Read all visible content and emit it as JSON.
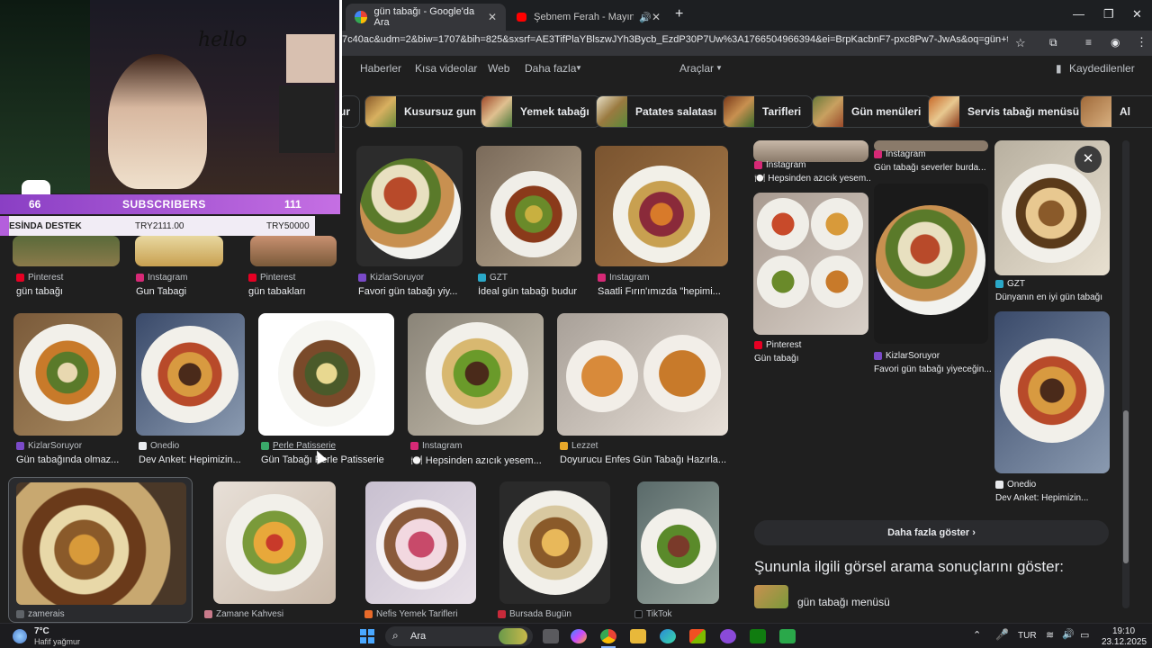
{
  "tabs": [
    {
      "title": "gün tabağı - Google'da Ara",
      "active": true
    },
    {
      "title": "Şebnem Ferah - Mayın Tarla",
      "active": false
    }
  ],
  "address": {
    "url": "7c40ac&udm=2&biw=1707&bih=825&sxsrf=AE3TifPlaYBlszwJYh3Bycb_EzdP30P7Uw%3A1766504966394&ei=BrpKacbnF7-pxc8Pw7-JwAs&oq=gün+tab&g..."
  },
  "google_nav": {
    "haberler": "Haberler",
    "kisa_videolar": "Kısa videolar",
    "web": "Web",
    "daha_fazla": "Daha fazla",
    "araclar": "Araçlar",
    "kaydedilenler": "Kaydedilenler"
  },
  "chips": [
    "ur",
    "Kusursuz gun",
    "Yemek tabağı",
    "Patates salatası",
    "Tarifleri",
    "Gün menüleri",
    "Servis tabağı menüsü",
    "Al"
  ],
  "row1": [
    {
      "source": "Pinterest",
      "title": "gün tabağı"
    },
    {
      "source": "Instagram",
      "title": "Gun Tabagi"
    },
    {
      "source": "Pinterest",
      "title": "gün tabakları"
    },
    {
      "source": "KizlarSoruyor",
      "title": "Favori gün tabağı yiy..."
    },
    {
      "source": "GZT",
      "title": "İdeal gün tabağı budur"
    },
    {
      "source": "Instagram",
      "title": "Saatli Fırın'ımızda \"hepimi..."
    }
  ],
  "row2": [
    {
      "source": "KizlarSoruyor",
      "title": "Gün tabağında olmaz..."
    },
    {
      "source": "Onedio",
      "title": "Dev Anket: Hepimizin..."
    },
    {
      "source": "Perle Patisserie",
      "title": "Gün Tabağı Perle Patisserie"
    },
    {
      "source": "Instagram",
      "title": "🍽️ Hepsinden azıcık yesem..."
    },
    {
      "source": "Lezzet",
      "title": "Doyurucu Enfes Gün Tabağı Hazırla..."
    }
  ],
  "row3": [
    {
      "source": "zamerais"
    },
    {
      "source": "Zamane Kahvesi"
    },
    {
      "source": "Nefis Yemek Tarifleri"
    },
    {
      "source": "Bursada Bugün"
    },
    {
      "source": "TikTok"
    }
  ],
  "panel": {
    "top_left": {
      "source": "Instagram",
      "title": "🍽️ Hepsinden azıcık yesem..."
    },
    "top_mid": {
      "source": "Instagram",
      "title": "Gün tabağı severler burda..."
    },
    "gzt": {
      "source": "GZT",
      "title": "Dünyanın en iyi gün tabağı"
    },
    "pinterest": {
      "source": "Pinterest",
      "title": "Gün tabağı"
    },
    "kizlar": {
      "source": "KizlarSoruyor",
      "title": "Favori gün tabağı yiyeceğin..."
    },
    "onedio": {
      "source": "Onedio",
      "title": "Dev Anket: Hepimizin..."
    },
    "more_button": "Daha fazla göster",
    "related_heading": "Şununla ilgili görsel arama sonuçlarını göster:",
    "related_item": "gün tabağı menüsü"
  },
  "overlay": {
    "hello": "hello",
    "sub_count": "66",
    "subscribers_label": "SUBSCRIBERS",
    "sub_goal": "111",
    "donation_label": "ESİNDA DESTEK",
    "donation_amount": "TRY2111.00",
    "donation_goal": "TRY50000"
  },
  "taskbar": {
    "weather_temp": "7°C",
    "weather_desc": "Hafif yağmur",
    "search": "Ara",
    "lang": "TUR",
    "time": "19:10",
    "date": "23.12.2025"
  },
  "colors": {
    "background": "#1f1f1f",
    "chrome": "#35363a",
    "sub_bar": "#b45fdc",
    "accent": "#8ab4f8"
  }
}
